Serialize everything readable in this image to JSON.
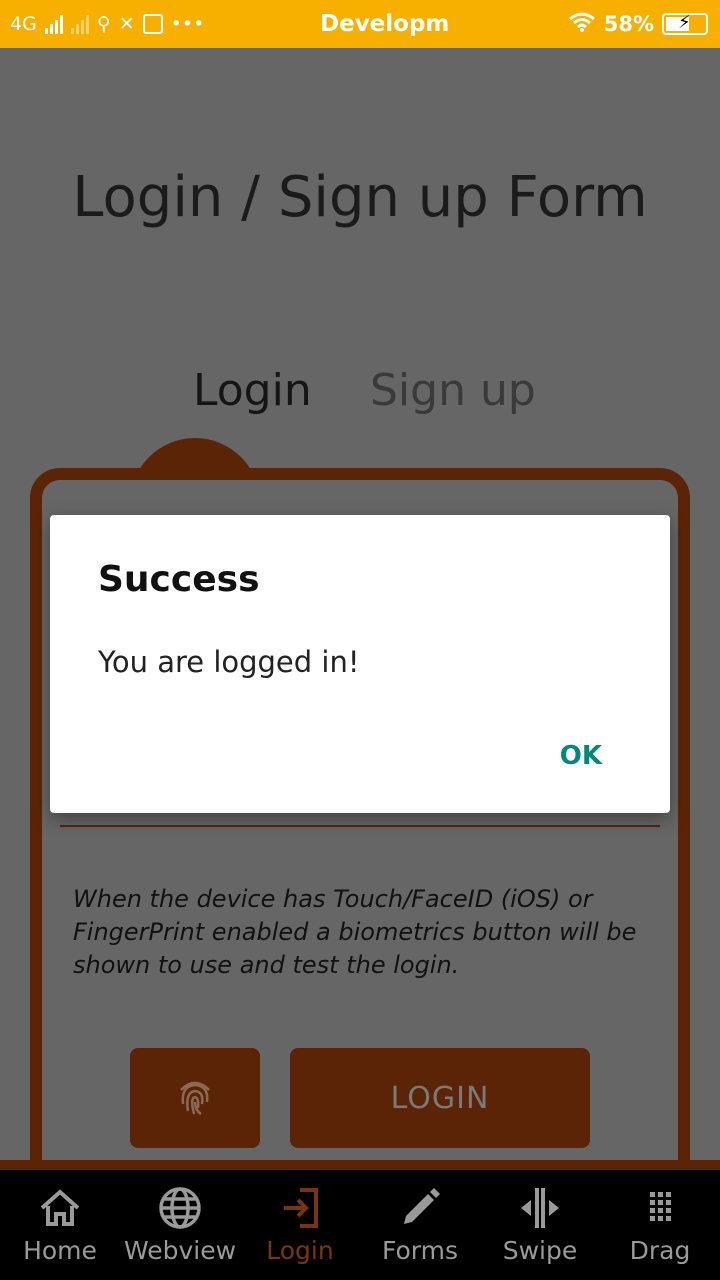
{
  "status_bar": {
    "network": "4G",
    "title": "Developme",
    "battery": "58%"
  },
  "page": {
    "title": "Login / Sign up Form",
    "tabs": [
      {
        "label": "Login",
        "active": true
      },
      {
        "label": "Sign up",
        "active": false
      }
    ],
    "biometric_note": "When the device has Touch/FaceID (iOS) or FingerPrint enabled a biometrics button will be shown to use and test the login.",
    "login_button": "LOGIN"
  },
  "dialog": {
    "title": "Success",
    "message": "You are logged in!",
    "ok_label": "OK"
  },
  "bottom_nav": {
    "items": [
      {
        "label": "Home",
        "icon": "home-icon",
        "active": false
      },
      {
        "label": "Webview",
        "icon": "globe-icon",
        "active": false
      },
      {
        "label": "Login",
        "icon": "login-icon",
        "active": true
      },
      {
        "label": "Forms",
        "icon": "pencil-icon",
        "active": false
      },
      {
        "label": "Swipe",
        "icon": "swipe-icon",
        "active": false
      },
      {
        "label": "Drag",
        "icon": "grid-icon",
        "active": false
      }
    ]
  },
  "colors": {
    "status_bar": "#f7b000",
    "accent": "#5b2407",
    "active_nav": "#7a3410",
    "dialog_button": "#00897b"
  }
}
